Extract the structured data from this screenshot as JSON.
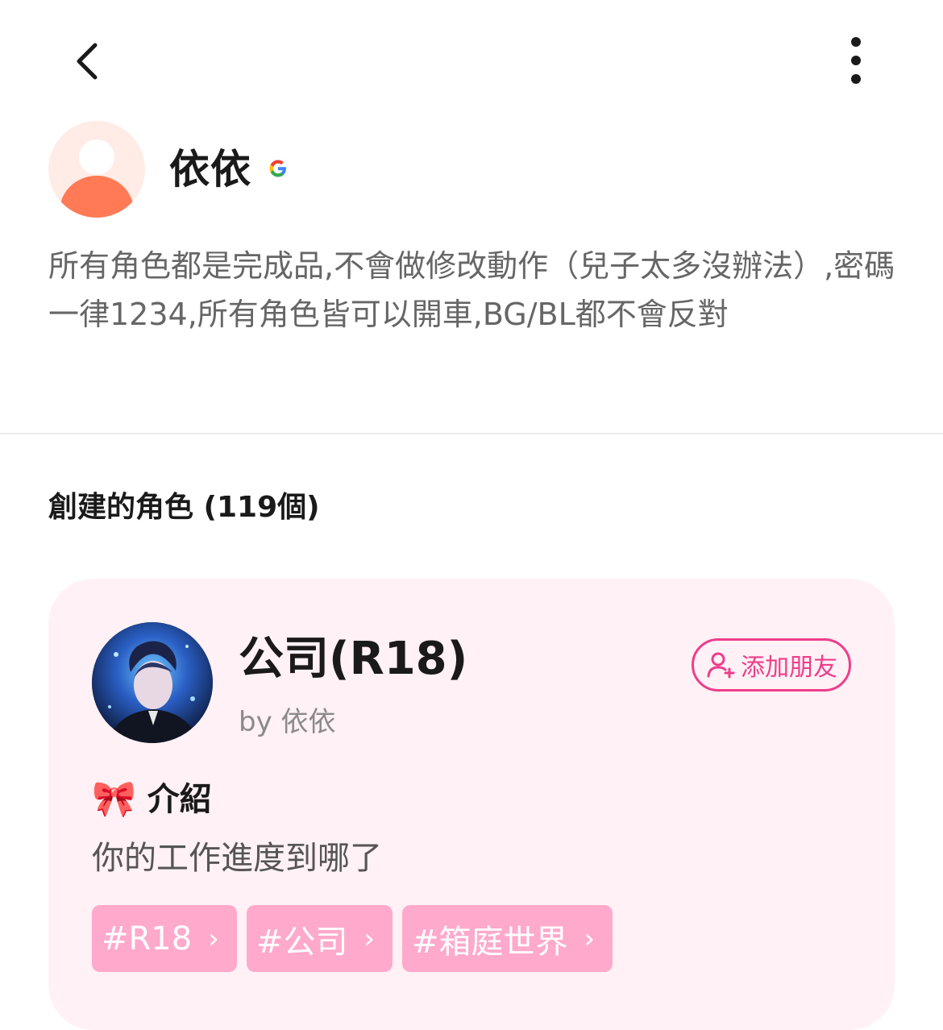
{
  "profile": {
    "name": "依依",
    "bio": "所有角色都是完成品,不會做修改動作（兒子太多沒辦法）,密碼一律1234,所有角色皆可以開車,BG/BL都不會反對"
  },
  "section": {
    "title": "創建的角色 (119個)"
  },
  "character": {
    "name": "公司(R18)",
    "by": "by 依依",
    "add_friend_label": "添加朋友",
    "intro_emoji": "🎀",
    "intro_label": "介紹",
    "intro_text": "你的工作進度到哪了",
    "tags": [
      "#R18",
      "#公司",
      "#箱庭世界"
    ]
  },
  "icons": {
    "back": "chevron-left-icon",
    "more": "more-vertical-icon",
    "google": "google-icon",
    "add_friend": "person-add-icon",
    "tag_chevron": "chevron-right-icon"
  },
  "colors": {
    "accent": "#ee3d8a",
    "card_bg": "#fff1f5",
    "tag_bg": "#ffa9cc",
    "avatar_bg": "#ffece6",
    "avatar_figure": "#ff7a55"
  }
}
